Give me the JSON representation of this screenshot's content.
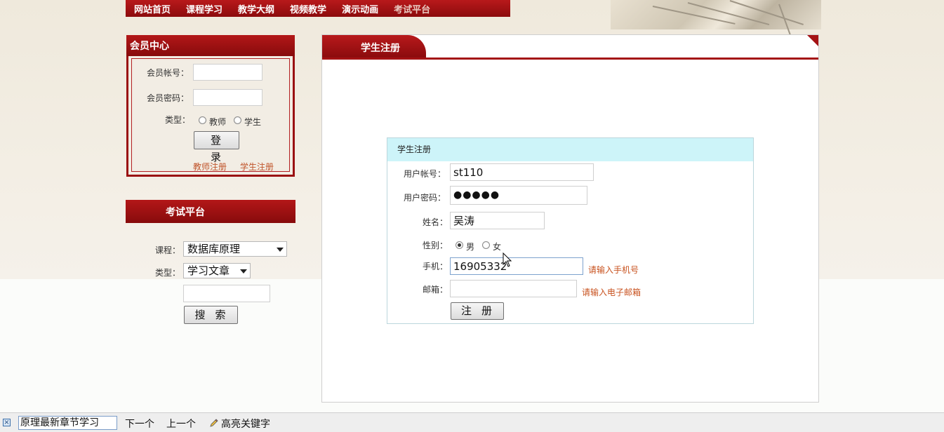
{
  "nav": {
    "items": [
      "网站首页",
      "课程学习",
      "教学大纲",
      "视频教学",
      "演示动画",
      "考试平台"
    ]
  },
  "member": {
    "title": "会员中心",
    "account_label": "会员帐号：",
    "password_label": "会员密码：",
    "type_label": "类型：",
    "type_teacher": "教师",
    "type_student": "学生",
    "login_button": "登录",
    "teacher_register": "教师注册",
    "student_register": "学生注册"
  },
  "exam": {
    "title": "考试平台",
    "course_label": "课程：",
    "course_selected": "数据库原理",
    "type_label": "类型：",
    "type_selected": "学习文章",
    "search_value": "",
    "search_button": "搜索"
  },
  "main": {
    "tab_title": "学生注册",
    "form": {
      "title": "学生注册",
      "username_label": "用户帐号：",
      "username_value": "st110",
      "password_label": "用户密码：",
      "password_value": "●●●●●",
      "name_label": "姓名：",
      "name_value": "吴涛",
      "gender_label": "性别：",
      "gender_male": "男",
      "gender_female": "女",
      "phone_label": "手机：",
      "phone_value": "16905332",
      "phone_hint": "请输入手机号",
      "email_label": "邮箱：",
      "email_value": "",
      "email_hint": "请输入电子邮箱",
      "submit_button": "注册"
    }
  },
  "findbar": {
    "query": "原理最新章节学习",
    "next": "下一个",
    "prev": "上一个",
    "highlight": "高亮关键字"
  },
  "colors": {
    "brand_red": "#a41214",
    "form_header": "#cdf4f9",
    "hint_orange": "#c8521f"
  }
}
